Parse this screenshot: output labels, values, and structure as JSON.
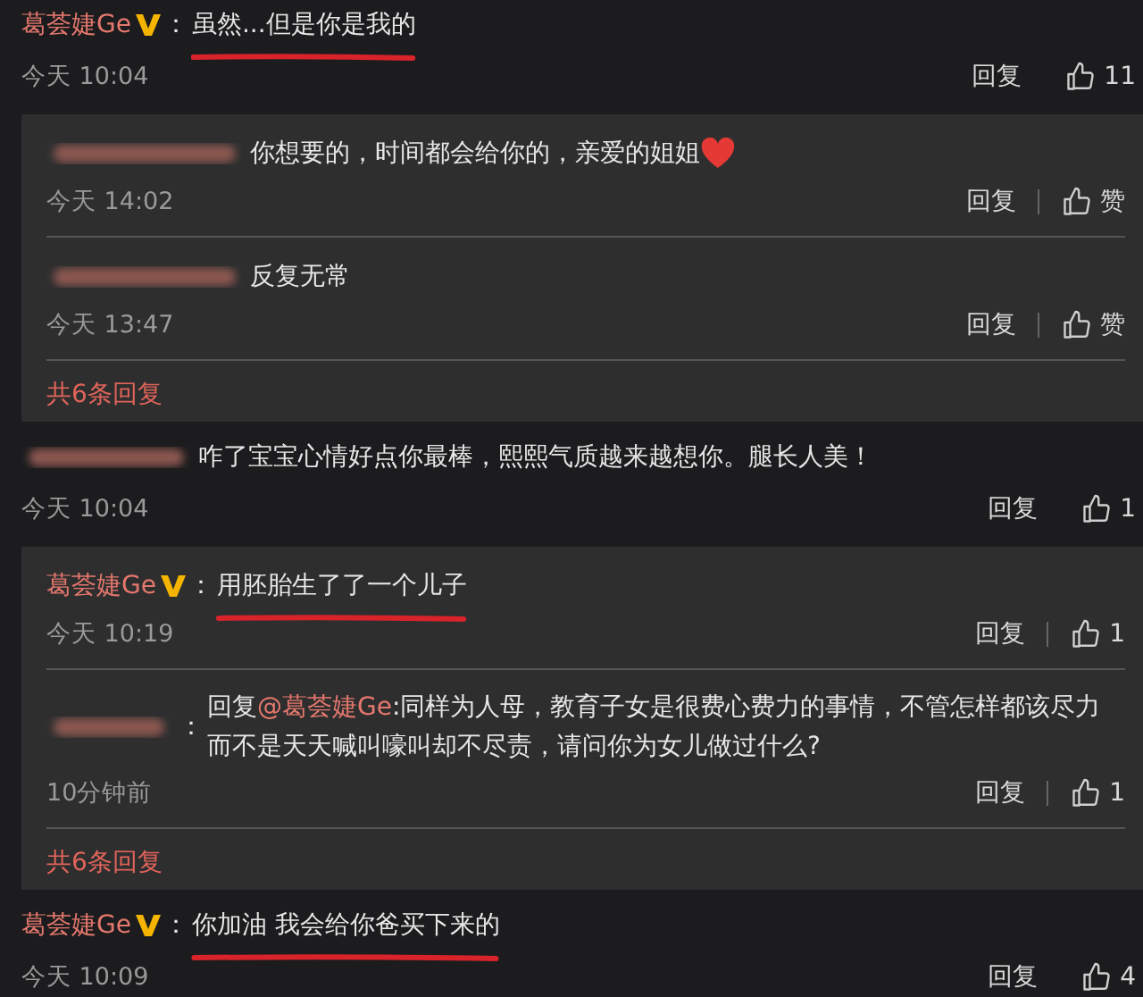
{
  "items": [
    {
      "kind": "comment",
      "author": {
        "kind": "named",
        "name": "葛荟婕Ge"
      },
      "verified": true,
      "colon": "：",
      "text": [
        {
          "kind": "plain",
          "text": "虽然...但是你是我的"
        }
      ],
      "underlined": true,
      "time": "今天 10:04",
      "reply_label": "回复",
      "likes": "11"
    },
    {
      "kind": "thread",
      "more": "共6条回复",
      "replies": [
        {
          "author": {
            "kind": "blurred"
          },
          "text": [
            {
              "kind": "plain",
              "text": "你想要的，时间都会给你的，亲爱的姐姐"
            }
          ],
          "heart": true,
          "underlined": false,
          "time": "今天 14:02",
          "reply_label": "回复",
          "like_label": "赞"
        },
        {
          "author": {
            "kind": "blurred"
          },
          "text": [
            {
              "kind": "plain",
              "text": "反复无常"
            }
          ],
          "heart": false,
          "underlined": false,
          "time": "今天 13:47",
          "reply_label": "回复",
          "like_label": "赞"
        }
      ]
    },
    {
      "kind": "comment",
      "author": {
        "kind": "blurred"
      },
      "text": [
        {
          "kind": "plain",
          "text": "咋了宝宝心情好点你最棒，熙熙气质越来越想你。腿长人美！"
        }
      ],
      "underlined": false,
      "time": "今天 10:04",
      "reply_label": "回复",
      "likes": "1"
    },
    {
      "kind": "thread",
      "more": "共6条回复",
      "replies": [
        {
          "author": {
            "kind": "named",
            "name": "葛荟婕Ge"
          },
          "verified": true,
          "colon": "：",
          "text": [
            {
              "kind": "plain",
              "text": "用胚胎生了了一个儿子"
            }
          ],
          "heart": false,
          "underlined": true,
          "time": "今天 10:19",
          "reply_label": "回复",
          "like_label": "1"
        },
        {
          "author": {
            "kind": "blurred"
          },
          "colon": "：",
          "text": [
            {
              "kind": "plain",
              "text": "回复"
            },
            {
              "kind": "mention",
              "text": "@葛荟婕Ge"
            },
            {
              "kind": "plain",
              "text": ":同样为人母，教育子女是很费心费力的事情，不管怎样都该尽力而不是天天喊叫嚎叫却不尽责，请问你为女儿做过什么?"
            }
          ],
          "heart": false,
          "underlined": false,
          "time": "10分钟前",
          "reply_label": "回复",
          "like_label": "1"
        }
      ]
    },
    {
      "kind": "comment",
      "author": {
        "kind": "named",
        "name": "葛荟婕Ge"
      },
      "verified": true,
      "colon": "：",
      "text": [
        {
          "kind": "plain",
          "text": "你加油 我会给你爸买下来的"
        }
      ],
      "underlined": true,
      "time": "今天 10:09",
      "reply_label": "回复",
      "likes": "4"
    }
  ]
}
